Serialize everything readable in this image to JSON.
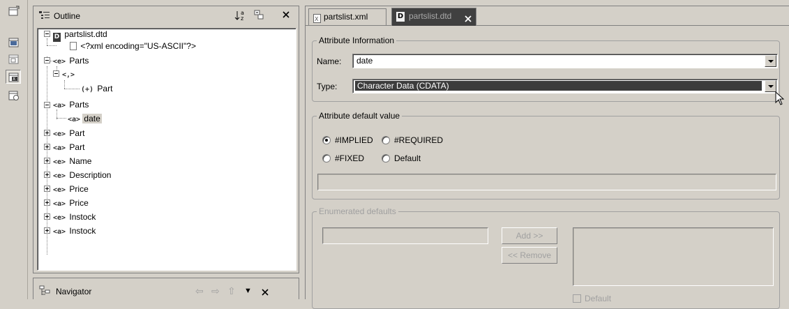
{
  "outline": {
    "title": "Outline",
    "tree": [
      {
        "label": "partslist.dtd"
      },
      {
        "label": "<?xml encoding=\"US-ASCII\"?>"
      },
      {
        "tag": "<e>",
        "label": "Parts"
      },
      {
        "tag": "<,>",
        "label": ""
      },
      {
        "tag": "(+)",
        "label": "Part"
      },
      {
        "tag": "<a>",
        "label": "Parts"
      },
      {
        "tag": "<a>",
        "label": "date"
      },
      {
        "tag": "<e>",
        "label": "Part"
      },
      {
        "tag": "<a>",
        "label": "Part"
      },
      {
        "tag": "<e>",
        "label": "Name"
      },
      {
        "tag": "<e>",
        "label": "Description"
      },
      {
        "tag": "<e>",
        "label": "Price"
      },
      {
        "tag": "<a>",
        "label": "Price"
      },
      {
        "tag": "<e>",
        "label": "Instock"
      },
      {
        "tag": "<a>",
        "label": "Instock"
      }
    ]
  },
  "navigator": {
    "title": "Navigator"
  },
  "editor": {
    "tabs": [
      {
        "label": "partslist.xml"
      },
      {
        "label": "partslist.dtd"
      }
    ],
    "attribute_info": {
      "title": "Attribute Information",
      "name_label": "Name:",
      "name_value": "date",
      "type_label": "Type:",
      "type_value": "Character Data (CDATA)"
    },
    "default_value": {
      "title": "Attribute default value",
      "options": [
        "#IMPLIED",
        "#REQUIRED",
        "#FIXED",
        "Default"
      ],
      "selected": "#IMPLIED"
    },
    "enumerated": {
      "title": "Enumerated defaults",
      "add_label": "Add >>",
      "remove_label": "<< Remove",
      "default_label": "Default"
    }
  }
}
